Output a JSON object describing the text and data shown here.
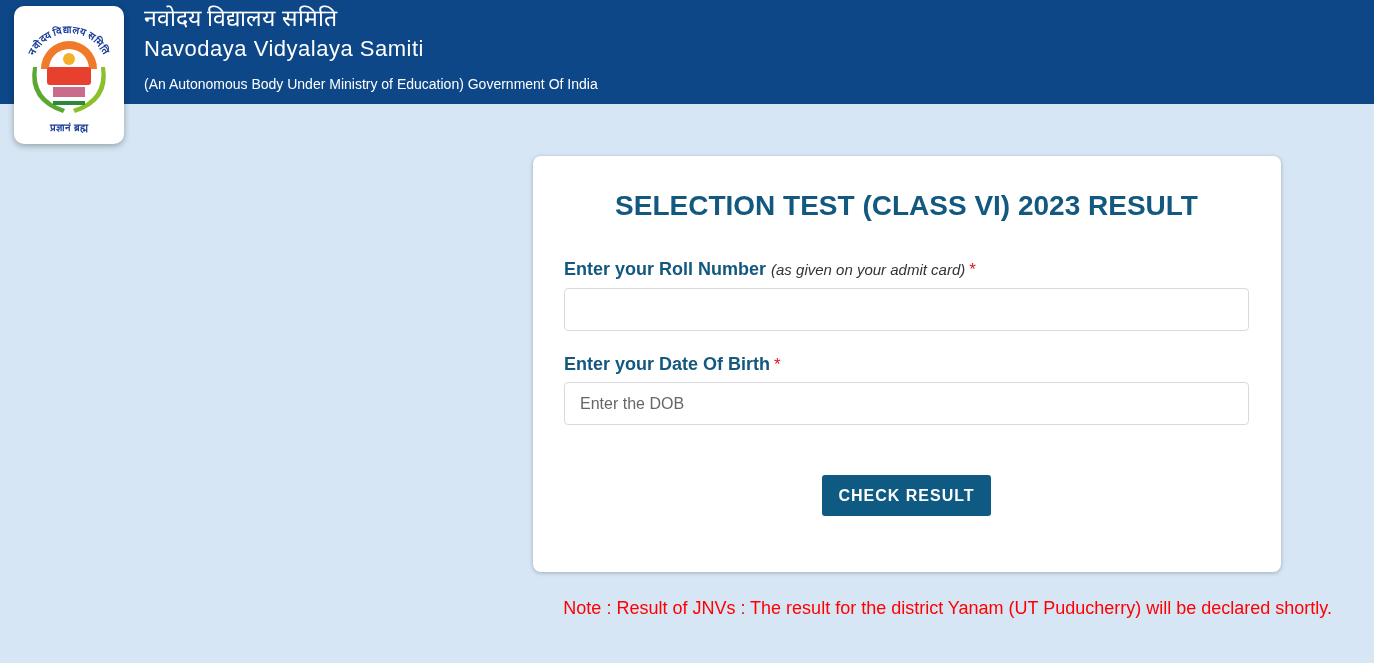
{
  "header": {
    "logo": {
      "arc_text": "नवोदय विद्यालय समिति",
      "motto": "प्रज्ञानं ब्रह्म"
    },
    "title_hindi": "नवोदय विद्यालय समिति",
    "title": "Navodaya Vidyalaya Samiti",
    "subtitle": "(An Autonomous Body Under Ministry of Education) Government Of India"
  },
  "form": {
    "title": "SELECTION TEST (CLASS VI) 2023 RESULT",
    "fields": [
      {
        "label": "Enter your Roll Number *(as given on your admit card)*",
        "required_mark": "*"
      },
      {
        "label": "Enter your Date Of Birth",
        "required_mark": "*",
        "placeholder": "Enter the DOB"
      }
    ],
    "button": "CHECK RESULT"
  },
  "note": "Note : Result of JNVs : The result for the district Yanam (UT Puducherry) will be declared shortly."
}
